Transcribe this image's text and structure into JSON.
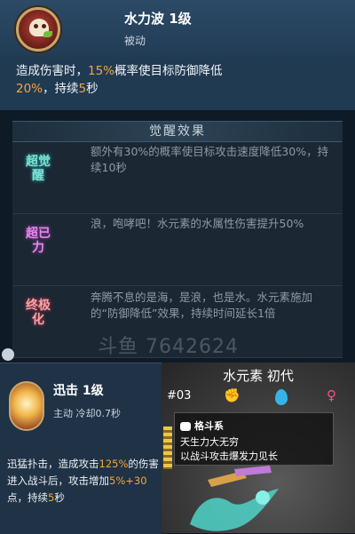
{
  "skill": {
    "title": "水力波 1级",
    "type": "被动",
    "desc_parts": [
      "造成伤害时，",
      "15%",
      "概率使目标防御降低",
      "20%",
      "，持续",
      "5",
      "秒"
    ]
  },
  "awaken": {
    "header": "觉醒效果",
    "rows": [
      {
        "badge": "超觉醒",
        "text": "额外有30%的概率使目标攻击速度降低30%，持续10秒"
      },
      {
        "badge": "超已力",
        "text": "浪，咆哮吧！水元素的水属性伤害提升50%"
      },
      {
        "badge": "终极化",
        "text": "奔腾不息的是海，是浪，也是水。水元素施加的“防御降低”效果，持续时间延长1倍"
      }
    ]
  },
  "watermark": "斗鱼 7642624",
  "move": {
    "title": "迅击 1级",
    "sub": "主动 冷却0.7秒",
    "desc_parts": [
      "迅猛扑击，造成攻击",
      "125%",
      "的伤害进入战斗后，攻击增加",
      "5%+30",
      "点，持续",
      "5",
      "秒"
    ]
  },
  "pokemon": {
    "title": "水元素 初代",
    "number": "#03",
    "trait_head": "格斗系",
    "trait_line1": "天生力大无穷",
    "trait_line2": "以战斗攻击爆发力见长"
  },
  "colors": {
    "highlight": "#f6a63a",
    "water": "#36b4e8",
    "female": "#ff4f8a"
  },
  "icons": [
    "skull-skill-icon",
    "fist-type-icon",
    "water-drop-icon",
    "female-icon",
    "burst-skill-icon"
  ]
}
